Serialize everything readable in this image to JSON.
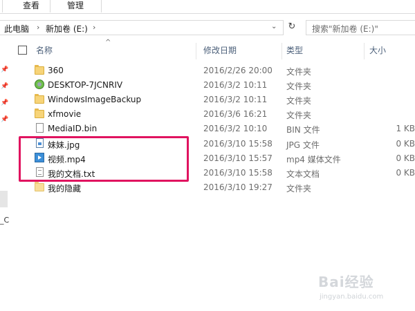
{
  "ribbon": {
    "tabs": [
      {
        "label": "查看"
      },
      {
        "label": "管理"
      }
    ]
  },
  "address": {
    "crumbs": [
      "此电脑",
      "新加卷 (E:)"
    ],
    "search_placeholder": "搜索\"新加卷 (E:)\""
  },
  "nav": {
    "partial_label": "_C"
  },
  "columns": {
    "name": "名称",
    "date": "修改日期",
    "type": "类型",
    "size": "大小"
  },
  "files": [
    {
      "name": "360",
      "date": "2016/2/26 20:00",
      "type": "文件夹",
      "size": "",
      "icon": "folder-icon"
    },
    {
      "name": "DESKTOP-7JCNRIV",
      "date": "2016/3/2 10:11",
      "type": "文件夹",
      "size": "",
      "icon": "backup-folder-icon"
    },
    {
      "name": "WindowsImageBackup",
      "date": "2016/3/2 10:11",
      "type": "文件夹",
      "size": "",
      "icon": "folder-icon"
    },
    {
      "name": "xfmovie",
      "date": "2016/3/6 16:21",
      "type": "文件夹",
      "size": "",
      "icon": "folder-icon"
    },
    {
      "name": "MediaID.bin",
      "date": "2016/3/2 10:10",
      "type": "BIN 文件",
      "size": "1 KB",
      "icon": "file-icon"
    },
    {
      "name": "妹妹.jpg",
      "date": "2016/3/10 15:58",
      "type": "JPG 文件",
      "size": "0 KB",
      "icon": "image-file-icon"
    },
    {
      "name": "视频.mp4",
      "date": "2016/3/10 15:57",
      "type": "mp4 媒体文件",
      "size": "0 KB",
      "icon": "video-file-icon"
    },
    {
      "name": "我的文档.txt",
      "date": "2016/3/10 15:58",
      "type": "文本文档",
      "size": "0 KB",
      "icon": "text-file-icon"
    },
    {
      "name": "我的隐藏",
      "date": "2016/3/10 19:27",
      "type": "文件夹",
      "size": "",
      "icon": "folder-icon"
    }
  ],
  "highlight_color": "#e0135f",
  "watermark": {
    "logo": "Bai经验",
    "sub": "jingyan.baidu.com"
  }
}
